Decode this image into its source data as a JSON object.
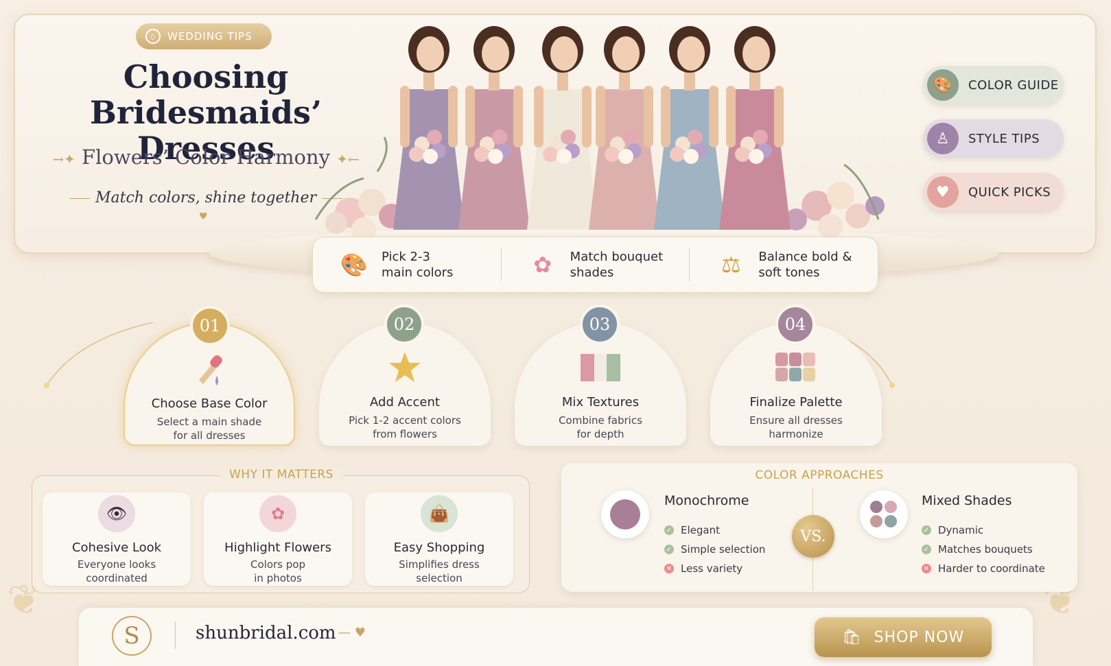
{
  "hero": {
    "badge": "WEDDING TIPS",
    "title_line1": "Choosing",
    "title_line2": "Bridesmaids’ Dresses",
    "subtitle": "Flowers’ Color Harmony",
    "tagline": "Match colors, shine together"
  },
  "side_buttons": [
    {
      "label": "COLOR GUIDE",
      "icon": "palette-icon"
    },
    {
      "label": "STYLE TIPS",
      "icon": "dress-icon"
    },
    {
      "label": "QUICK PICKS",
      "icon": "heart-icon"
    }
  ],
  "tips": [
    {
      "line1": "Pick 2-3",
      "line2": "main colors",
      "icon": "palette-icon"
    },
    {
      "line1": "Match bouquet",
      "line2": "shades",
      "icon": "flower-icon"
    },
    {
      "line1": "Balance bold &",
      "line2": "soft tones",
      "icon": "scale-icon"
    }
  ],
  "steps": [
    {
      "num": "01",
      "title": "Choose Base Color",
      "desc1": "Select a main shade",
      "desc2": "for all dresses",
      "icon": "dropper-icon",
      "color": "#d4ad5f"
    },
    {
      "num": "02",
      "title": "Add Accent",
      "desc1": "Pick 1-2 accent colors",
      "desc2": "from flowers",
      "icon": "star-icon",
      "color": "#8ea18c"
    },
    {
      "num": "03",
      "title": "Mix Textures",
      "desc1": "Combine fabrics",
      "desc2": "for depth",
      "icon": "fabric-icon",
      "color": "#8293a6"
    },
    {
      "num": "04",
      "title": "Finalize Palette",
      "desc1": "Ensure all dresses",
      "desc2": "harmonize",
      "icon": "palette-grid-icon",
      "color": "#a5869d"
    }
  ],
  "why": {
    "title": "WHY IT MATTERS",
    "cards": [
      {
        "title": "Cohesive Look",
        "desc1": "Everyone looks",
        "desc2": "coordinated",
        "icon": "eye-icon"
      },
      {
        "title": "Highlight Flowers",
        "desc1": "Colors pop",
        "desc2": "in photos",
        "icon": "flower-icon"
      },
      {
        "title": "Easy Shopping",
        "desc1": "Simplifies dress",
        "desc2": "selection",
        "icon": "bag-icon"
      }
    ]
  },
  "approaches": {
    "title": "COLOR APPROACHES",
    "vs": "VS.",
    "left": {
      "name": "Monochrome",
      "items": [
        "Elegant",
        "Simple selection",
        "Less variety"
      ]
    },
    "right": {
      "name": "Mixed Shades",
      "items": [
        "Dynamic",
        "Matches bouquets",
        "Harder to coordinate"
      ]
    }
  },
  "footer": {
    "logo": "S",
    "site": "shunbridal.com",
    "cta": "SHOP NOW"
  },
  "colors": {
    "gold": "#c9a567",
    "dresses": [
      "#a493b0",
      "#c99aa6",
      "#f0e8da",
      "#dcb1ad",
      "#9fb3c2",
      "#c98b9b"
    ]
  }
}
